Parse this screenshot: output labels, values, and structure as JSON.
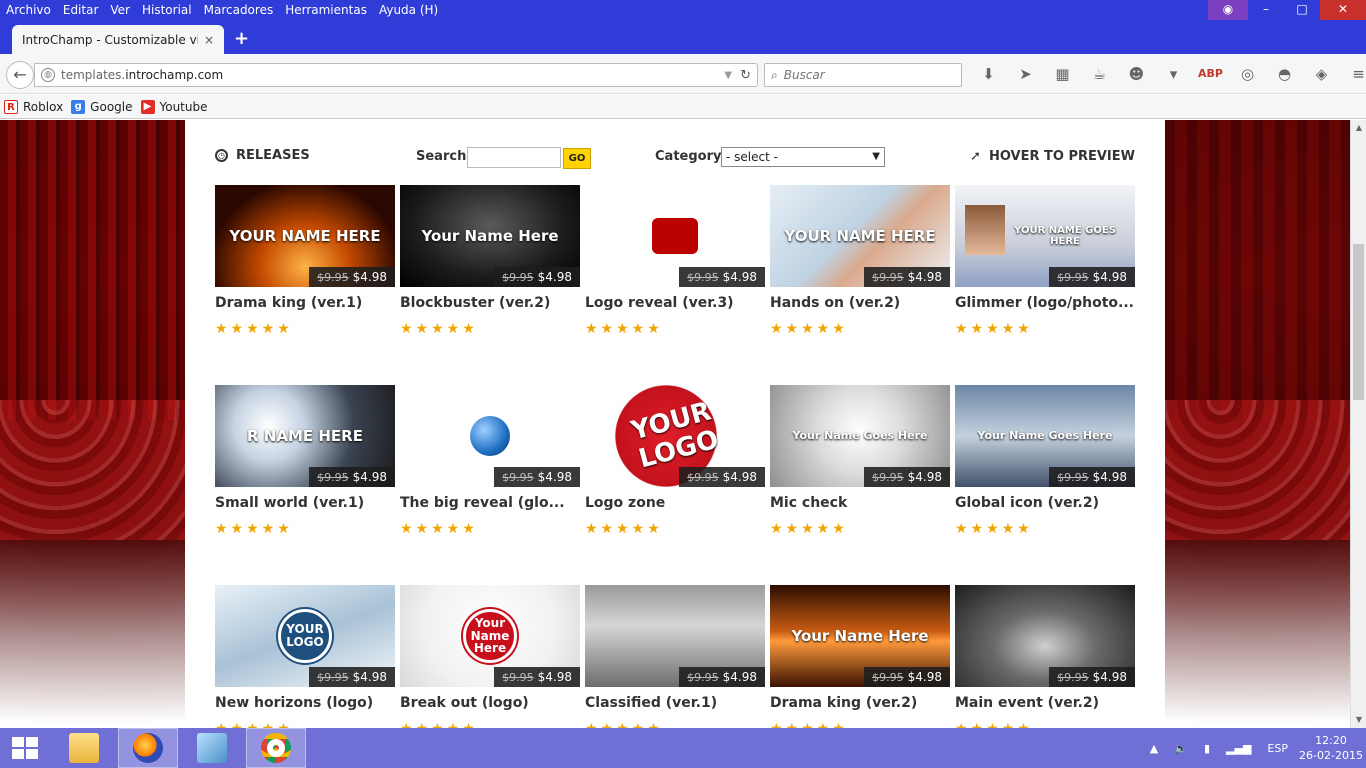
{
  "menu": {
    "items": [
      "Archivo",
      "Editar",
      "Ver",
      "Historial",
      "Marcadores",
      "Herramientas",
      "Ayuda (H)"
    ]
  },
  "tab": {
    "title": "IntroChamp - Customizable vi...",
    "close": "×",
    "new": "+"
  },
  "nav": {
    "url_prefix": "templates.",
    "url_domain": "introchamp.com",
    "search_placeholder": "Buscar"
  },
  "bookmarks": [
    {
      "label": "Roblox",
      "icon": "roblox-icon"
    },
    {
      "label": "Google",
      "icon": "google-icon"
    },
    {
      "label": "Youtube",
      "icon": "youtube-icon"
    }
  ],
  "page": {
    "releases": "RELEASES",
    "search_label": "Search",
    "go": "GO",
    "category_label": "Category",
    "category_selected": "- select -",
    "hover": "HOVER TO PREVIEW"
  },
  "templates": [
    {
      "title": "Drama king (ver.1)",
      "old": "$9.95",
      "price": "$4.98",
      "stars": "★★★★★",
      "thumb": "YOUR NAME HERE"
    },
    {
      "title": "Blockbuster (ver.2)",
      "old": "$9.95",
      "price": "$4.98",
      "stars": "★★★★★",
      "thumb": "Your Name Here"
    },
    {
      "title": "Logo reveal (ver.3)",
      "old": "$9.95",
      "price": "$4.98",
      "stars": "★★★★★",
      "thumb": ""
    },
    {
      "title": "Hands on (ver.2)",
      "old": "$9.95",
      "price": "$4.98",
      "stars": "★★★★★",
      "thumb": "YOUR NAME HERE"
    },
    {
      "title": "Glimmer (logo/photo...",
      "old": "$9.95",
      "price": "$4.98",
      "stars": "★★★★★",
      "thumb": "YOUR NAME GOES HERE"
    },
    {
      "title": "Small world (ver.1)",
      "old": "$9.95",
      "price": "$4.98",
      "stars": "★★★★★",
      "thumb": "R NAME HERE"
    },
    {
      "title": "The big reveal (glo...",
      "old": "$9.95",
      "price": "$4.98",
      "stars": "★★★★★",
      "thumb": ""
    },
    {
      "title": "Logo zone",
      "old": "$9.95",
      "price": "$4.98",
      "stars": "★★★★★",
      "thumb": "YOUR LOGO"
    },
    {
      "title": "Mic check",
      "old": "$9.95",
      "price": "$4.98",
      "stars": "★★★★★",
      "thumb": "Your Name Goes Here"
    },
    {
      "title": "Global icon (ver.2)",
      "old": "$9.95",
      "price": "$4.98",
      "stars": "★★★★★",
      "thumb": "Your Name Goes Here"
    },
    {
      "title": "New horizons (logo)",
      "old": "$9.95",
      "price": "$4.98",
      "stars": "★★★★★",
      "thumb": "YOUR LOGO"
    },
    {
      "title": "Break out (logo)",
      "old": "$9.95",
      "price": "$4.98",
      "stars": "★★★★★",
      "thumb": "Your Name Here"
    },
    {
      "title": "Classified (ver.1)",
      "old": "$9.95",
      "price": "$4.98",
      "stars": "★★★★★",
      "thumb": ""
    },
    {
      "title": "Drama king (ver.2)",
      "old": "$9.95",
      "price": "$4.98",
      "stars": "★★★★★",
      "thumb": "Your Name Here"
    },
    {
      "title": "Main event (ver.2)",
      "old": "$9.95",
      "price": "$4.98",
      "stars": "★★★★★",
      "thumb": ""
    }
  ],
  "taskbar": {
    "apps": [
      "file-explorer-icon",
      "firefox-icon",
      "notebook-icon",
      "chrome-icon"
    ],
    "lang": "ESP",
    "time": "12:20",
    "date": "26-02-2015"
  }
}
